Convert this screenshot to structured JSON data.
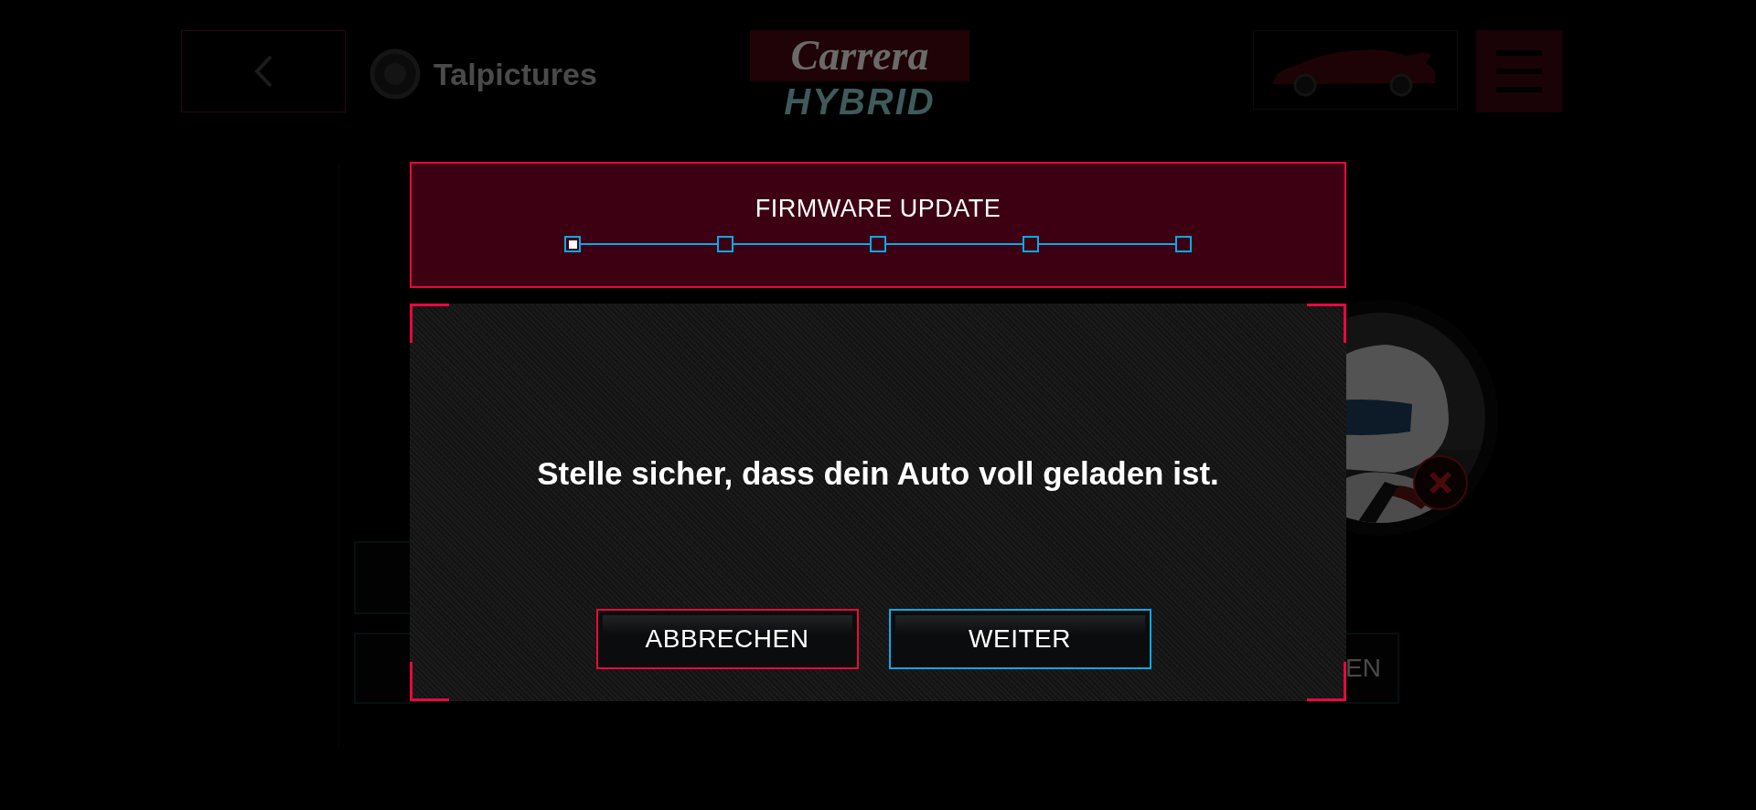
{
  "background": {
    "profile": {
      "name": "Talpictures"
    },
    "logo": {
      "brand": "Carrera",
      "product": "HYBRID"
    },
    "partial_button": {
      "label": "EN"
    }
  },
  "dialog": {
    "title": "FIRMWARE UPDATE",
    "steps": [
      {
        "selected": true
      },
      {
        "selected": false
      },
      {
        "selected": false
      },
      {
        "selected": false
      },
      {
        "selected": false
      }
    ],
    "message": "Stelle sicher, dass dein Auto voll geladen ist.",
    "buttons": [
      {
        "label": "ABBRECHEN",
        "kind": "cancel"
      },
      {
        "label": "WEITER",
        "kind": "confirm"
      }
    ]
  }
}
